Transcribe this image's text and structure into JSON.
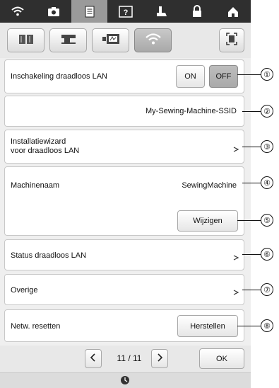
{
  "top_tabs": [
    {
      "icon": "wifi-icon"
    },
    {
      "icon": "camera-icon"
    },
    {
      "icon": "document-icon",
      "active": true
    },
    {
      "icon": "help-icon"
    },
    {
      "icon": "presser-foot-icon"
    },
    {
      "icon": "lock-icon"
    },
    {
      "icon": "home-icon"
    }
  ],
  "sub_tabs": [
    {
      "icon": "book-icon"
    },
    {
      "icon": "sewing-machine-icon"
    },
    {
      "icon": "embroidery-icon"
    },
    {
      "icon": "wifi-icon",
      "active": true
    },
    {
      "icon": "screen-capture-icon"
    }
  ],
  "wireless_lan": {
    "label": "Inschakeling draadloos LAN",
    "on_label": "ON",
    "off_label": "OFF",
    "selected": "OFF"
  },
  "ssid": "My-Sewing-Machine-SSID",
  "setup_wizard": {
    "line1": "Installatiewizard",
    "line2": "voor draadloos LAN"
  },
  "machine_name": {
    "label": "Machinenaam",
    "value": "SewingMachine",
    "change_label": "Wijzigen"
  },
  "wlan_status": {
    "label": "Status draadloos LAN"
  },
  "other": {
    "label": "Overige"
  },
  "network_reset": {
    "label": "Netw. resetten",
    "button_label": "Herstellen"
  },
  "footer": {
    "page": "11 / 11",
    "ok_label": "OK"
  },
  "callouts": [
    "①",
    "②",
    "③",
    "④",
    "⑤",
    "⑥",
    "⑦",
    "⑧"
  ]
}
